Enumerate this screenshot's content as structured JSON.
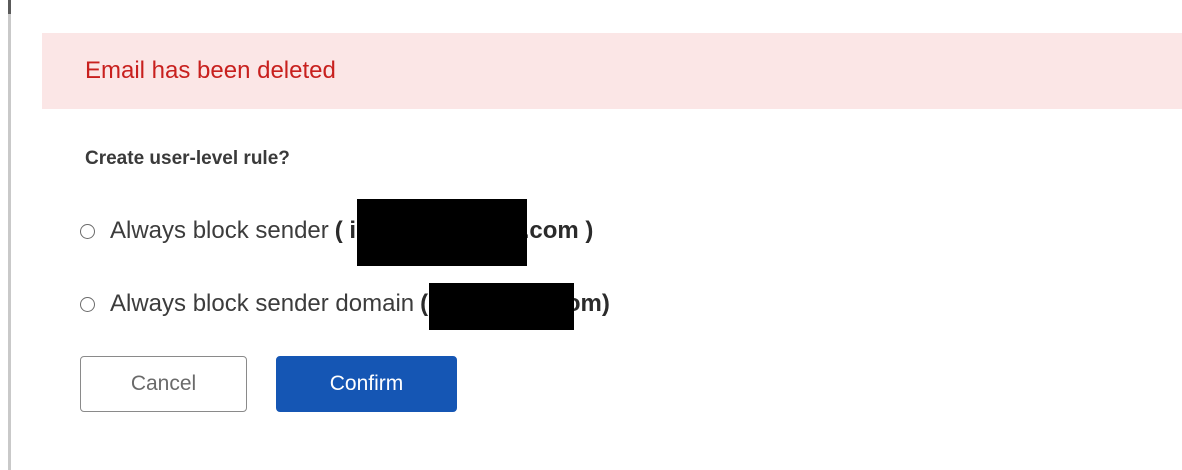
{
  "banner": {
    "message": "Email has been deleted",
    "text_color": "#c8201e",
    "background_color": "#fbe6e6"
  },
  "prompt": {
    "question": "Create user-level rule?"
  },
  "options": [
    {
      "label": "Always block sender",
      "value_prefix": "( inf",
      "value_suffix": ".com )",
      "selected": false
    },
    {
      "label": "Always block sender domain",
      "value_prefix": "(p",
      "value_suffix": "om)",
      "selected": false
    }
  ],
  "actions": {
    "cancel_label": "Cancel",
    "confirm_label": "Confirm",
    "confirm_color": "#1556b4"
  }
}
